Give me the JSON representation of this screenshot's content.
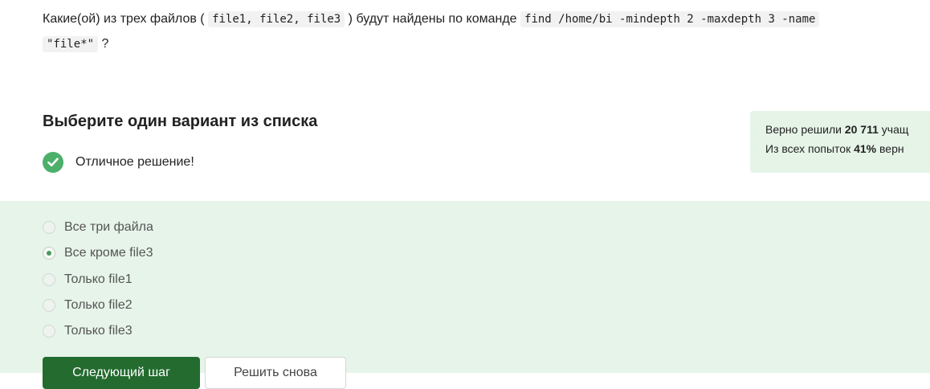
{
  "question": {
    "prefix": "Какие(ой) из трех файлов ( ",
    "files_code": "file1, file2, file3",
    "middle": " ) будут найдены по команде ",
    "command_code": "find /home/bi -mindepth 2 -maxdepth 3 -name",
    "pattern_code": "\"file*\"",
    "suffix": " ?"
  },
  "title": "Выберите один вариант из списка",
  "feedback": {
    "text": "Отличное решение!",
    "icon": "check-circle-icon",
    "color": "#4caf6a"
  },
  "stats": {
    "line1_prefix": "Верно решили ",
    "line1_count": "20 711",
    "line1_suffix": " учащ",
    "line2_prefix": "Из всех попыток ",
    "line2_percent": "41%",
    "line2_suffix": " верн"
  },
  "options": [
    {
      "label": "Все три файла",
      "checked": false
    },
    {
      "label": "Все кроме file3",
      "checked": true
    },
    {
      "label": "Только file1",
      "checked": false
    },
    {
      "label": "Только file2",
      "checked": false
    },
    {
      "label": "Только file3",
      "checked": false
    }
  ],
  "buttons": {
    "submit": "Следующий шаг",
    "reset": "Решить снова"
  },
  "colors": {
    "accent_green": "#236b2f",
    "options_bg": "#e7f4e9",
    "stats_bg": "#e6f4e8"
  }
}
